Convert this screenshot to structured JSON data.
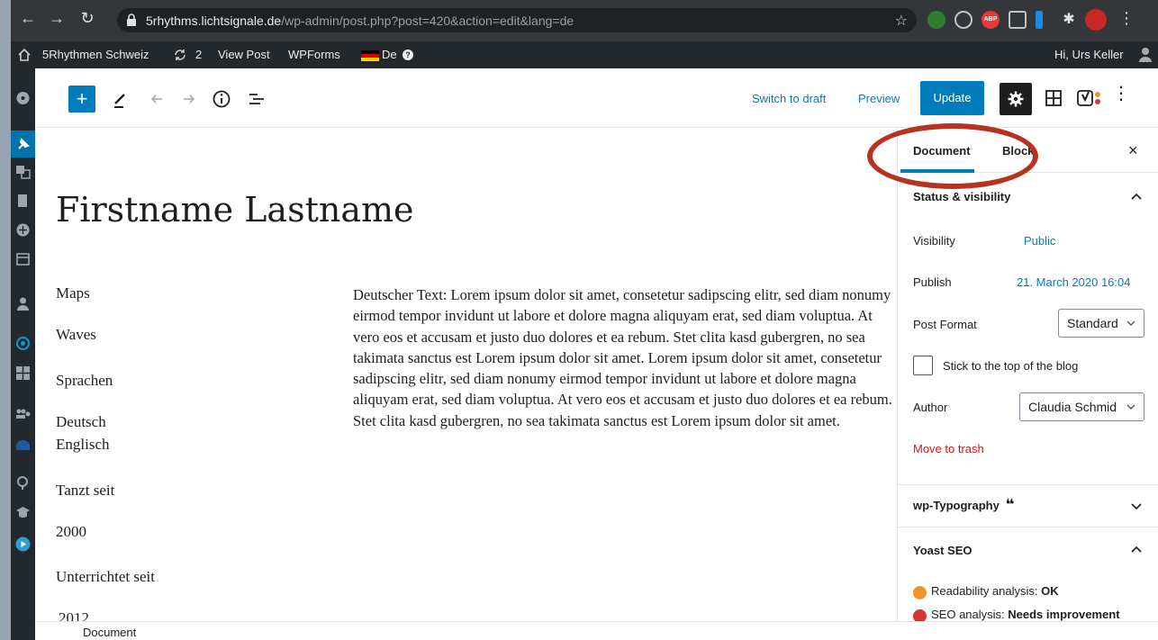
{
  "browser": {
    "url_host": "5rhythms.lichtsignale.de",
    "url_path": "/wp-admin/post.php?post=420&action=edit&lang=de",
    "extension_badge": "ABP"
  },
  "admin_bar": {
    "site_name": "5Rhythmen Schweiz",
    "updates_count": "2",
    "view_post": "View Post",
    "wpforms": "WPForms",
    "language": "De",
    "greeting": "Hi, Urs Keller"
  },
  "toolbar": {
    "switch_to_draft": "Switch to draft",
    "preview": "Preview",
    "update": "Update"
  },
  "content": {
    "title": "Firstname Lastname",
    "labels": [
      "Maps",
      "Waves",
      "Sprachen",
      "Deutsch",
      "Englisch",
      "Tanzt seit",
      "2000",
      "Unterrichtet seit",
      "2012"
    ],
    "body": "Deutscher Text: Lorem ipsum dolor sit amet, consetetur sadipscing elitr, sed diam nonumy eirmod tempor invidunt ut labore et dolore magna aliquyam erat, sed diam voluptua. At vero eos et accusam et justo duo dolores et ea rebum. Stet clita kasd gubergren, no sea takimata sanctus est Lorem ipsum dolor sit amet. Lorem ipsum dolor sit amet, consetetur sadipscing elitr, sed diam nonumy eirmod tempor invidunt ut labore et dolore magna aliquyam erat, sed diam voluptua. At vero eos et accusam et justo duo dolores et ea rebum. Stet clita kasd gubergren, no sea takimata sanctus est Lorem ipsum dolor sit amet."
  },
  "panel": {
    "tab_document": "Document",
    "tab_block": "Block",
    "status_title": "Status & visibility",
    "visibility_label": "Visibility",
    "visibility_value": "Public",
    "publish_label": "Publish",
    "publish_value": "21. March 2020 16:04",
    "post_format_label": "Post Format",
    "post_format_value": "Standard",
    "sticky_label": "Stick to the top of the blog",
    "author_label": "Author",
    "author_value": "Claudia Schmid",
    "move_to_trash": "Move to trash",
    "typography_title": "wp-Typography",
    "typography_quote": "❝",
    "yoast_title": "Yoast SEO",
    "readability_label": "Readability analysis: ",
    "readability_value": "OK",
    "seo_label": "SEO analysis: ",
    "seo_value": "Needs improvement"
  },
  "footer": {
    "breadcrumb": "Document"
  },
  "colors": {
    "accent": "#007cba",
    "admin_bar": "#23282d",
    "highlight_ring": "#b7321f",
    "trash": "#cc1818",
    "readability_ok": "#f0932b",
    "seo_bad": "#dc3232"
  }
}
